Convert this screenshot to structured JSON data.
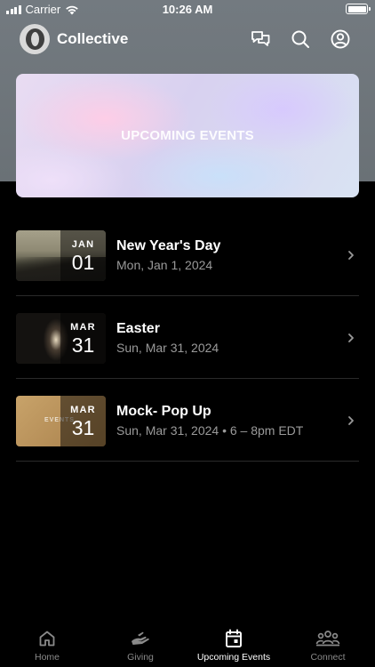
{
  "status_bar": {
    "carrier": "Carrier",
    "time": "10:26 AM"
  },
  "header": {
    "title": "Collective",
    "icons": [
      "chat-icon",
      "search-icon",
      "profile-icon"
    ]
  },
  "hero": {
    "title": "UPCOMING EVENTS"
  },
  "events": [
    {
      "month": "JAN",
      "day": "01",
      "title": "New Year's Day",
      "subtitle": "Mon, Jan 1, 2024"
    },
    {
      "month": "MAR",
      "day": "31",
      "title": "Easter",
      "subtitle": "Sun, Mar 31, 2024"
    },
    {
      "month": "MAR",
      "day": "31",
      "title": "Mock- Pop Up",
      "subtitle": "Sun, Mar 31, 2024 • 6 – 8pm EDT",
      "thumb_text": "EVENTS"
    }
  ],
  "tabs": [
    {
      "label": "Home",
      "icon": "home-icon",
      "active": false
    },
    {
      "label": "Giving",
      "icon": "giving-icon",
      "active": false
    },
    {
      "label": "Upcoming Events",
      "icon": "calendar-icon",
      "active": true
    },
    {
      "label": "Connect",
      "icon": "people-icon",
      "active": false
    }
  ],
  "colors": {
    "background": "#000000",
    "header": "#6f767b",
    "subtitle": "#9a9a9a",
    "inactive_tab": "#8a8a8a"
  }
}
